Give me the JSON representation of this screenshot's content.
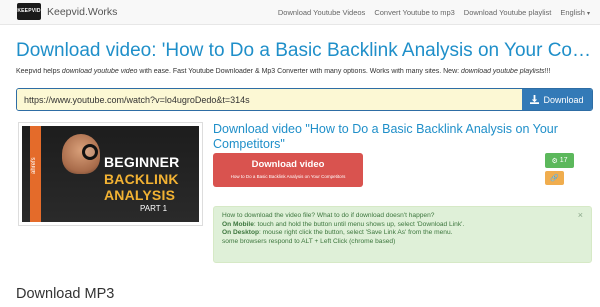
{
  "nav": {
    "logo_text": "KEEPVID",
    "brand": "Keepvid.Works",
    "links": [
      "Download Youtube Videos",
      "Convert Youtube to mp3",
      "Download Youtube playlist"
    ],
    "language": "English"
  },
  "page": {
    "title": "Download video: 'How to Do a Basic Backlink Analysis on Your Competitors'",
    "desc_prefix": "Keepvid helps ",
    "desc_em1": "download youtube video",
    "desc_mid": " with ease. Fast Youtube Downloader & Mp3 Converter with many options. Works with many sites. New: ",
    "desc_em2": "download youtube playlists",
    "desc_suffix": "!!!"
  },
  "search": {
    "value": "https://www.youtube.com/watch?v=lo4ugroDedo&t=314s",
    "button_label": "Download"
  },
  "thumbnail": {
    "brand": "ahrefs",
    "line1": "BEGINNER",
    "line2": "BACKLINK",
    "line3": "ANALYSIS",
    "line4": "PART 1"
  },
  "video": {
    "title": "Download video \"How to Do a Basic Backlink Analysis on Your Competitors\"",
    "button_label": "Download video",
    "button_sub": "How to Do a Basic Backlink Analysis on Your Competitors",
    "badge_count": "17"
  },
  "help": {
    "question": "How to download the video file? What to do if download doesn't happen?",
    "mobile_label": "On Mobile",
    "mobile_text": ": touch and hold the button until menu shows up, select 'Download Link'.",
    "desktop_label": "On Desktop",
    "desktop_text": ": mouse right click the button, select 'Save Link As' from the menu.",
    "alt_text": "some browsers respond to ALT + Left Click (chrome based)",
    "close": "×"
  },
  "section": {
    "title": "Download MP3"
  },
  "colors": {
    "accent": "#1f8fc9",
    "primary_button": "#337ab7",
    "danger_button": "#d9534f",
    "success": "#5cb85c",
    "warning": "#f0ad4e",
    "url_background": "#fcf8d4"
  }
}
